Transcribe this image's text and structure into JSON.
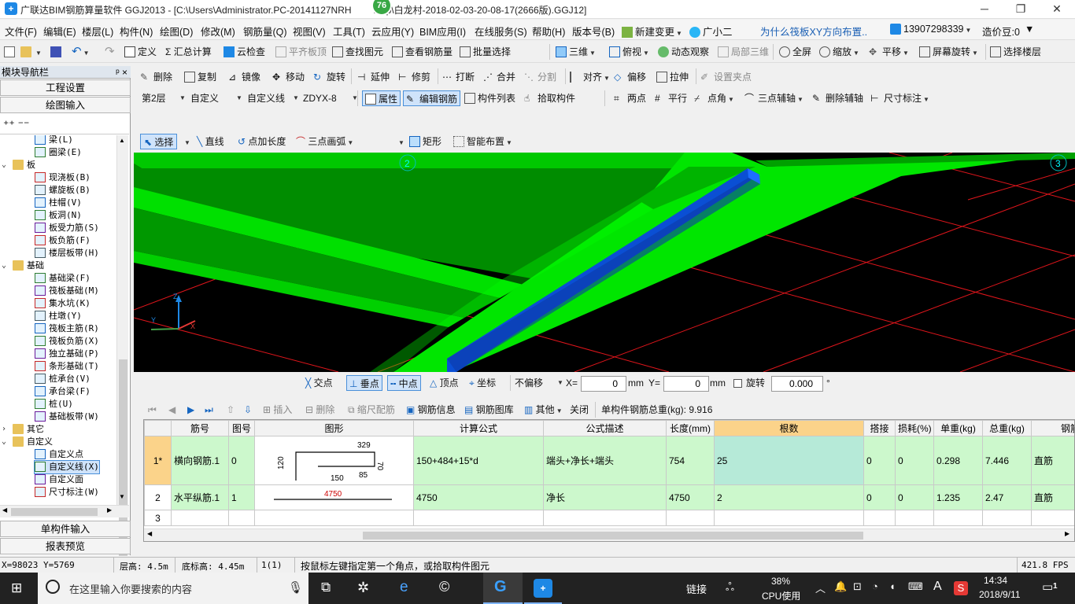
{
  "title": {
    "app": "广联达BIM钢筋算量软件 GGJ2013 - [C:\\Users\\Administrator.PC-20141127NRH",
    "app_tail": "ktop\\白龙村-2018-02-03-20-08-17(2666版).GGJ12]",
    "badge": "76"
  },
  "menu": [
    "文件(F)",
    "编辑(E)",
    "楼层(L)",
    "构件(N)",
    "绘图(D)",
    "修改(M)",
    "钢筋量(Q)",
    "视图(V)",
    "工具(T)",
    "云应用(Y)",
    "BIM应用(I)",
    "在线服务(S)",
    "帮助(H)",
    "版本号(B)",
    "新建变更",
    "广小二",
    "为什么筏板XY方向布置..",
    "13907298339",
    "造价豆:0"
  ],
  "toolbar1": [
    "定义",
    "Σ 汇总计算",
    "云检查",
    "平齐板顶",
    "查找图元",
    "查看钢筋量",
    "批量选择",
    "三维",
    "俯视",
    "动态观察",
    "局部三维",
    "全屏",
    "缩放",
    "平移",
    "屏幕旋转",
    "选择楼层"
  ],
  "toolbar2": [
    "删除",
    "复制",
    "镜像",
    "移动",
    "旋转",
    "延伸",
    "修剪",
    "打断",
    "合并",
    "分割",
    "对齐",
    "偏移",
    "拉伸",
    "设置夹点"
  ],
  "toolbar3": {
    "floor": "第2层",
    "type": "自定义",
    "subtype": "自定义线",
    "code": "ZDYX-8",
    "items": [
      "属性",
      "编辑钢筋",
      "构件列表",
      "拾取构件",
      "两点",
      "平行",
      "点角",
      "三点辅轴",
      "删除辅轴",
      "尺寸标注"
    ]
  },
  "toolbar4": [
    "选择",
    "直线",
    "点加长度",
    "三点画弧",
    "矩形",
    "智能布置"
  ],
  "nav": {
    "header": "模块导航栏",
    "pin": "ᵖ ×",
    "btn_engineering": "工程设置",
    "btn_draw": "绘图输入",
    "btn_single": "单构件输入",
    "btn_report": "报表预览"
  },
  "tree": [
    {
      "label": "梁(L)",
      "level": 2
    },
    {
      "label": "圈梁(E)",
      "level": 2
    },
    {
      "label": "板",
      "level": 1,
      "folder": true
    },
    {
      "label": "现浇板(B)",
      "level": 2
    },
    {
      "label": "螺旋板(B)",
      "level": 2
    },
    {
      "label": "柱帽(V)",
      "level": 2
    },
    {
      "label": "板洞(N)",
      "level": 2
    },
    {
      "label": "板受力筋(S)",
      "level": 2
    },
    {
      "label": "板负筋(F)",
      "level": 2
    },
    {
      "label": "楼层板带(H)",
      "level": 2
    },
    {
      "label": "基础",
      "level": 1,
      "folder": true
    },
    {
      "label": "基础梁(F)",
      "level": 2
    },
    {
      "label": "筏板基础(M)",
      "level": 2
    },
    {
      "label": "集水坑(K)",
      "level": 2
    },
    {
      "label": "柱墩(Y)",
      "level": 2
    },
    {
      "label": "筏板主筋(R)",
      "level": 2
    },
    {
      "label": "筏板负筋(X)",
      "level": 2
    },
    {
      "label": "独立基础(P)",
      "level": 2
    },
    {
      "label": "条形基础(T)",
      "level": 2
    },
    {
      "label": "桩承台(V)",
      "level": 2
    },
    {
      "label": "承台梁(F)",
      "level": 2
    },
    {
      "label": "桩(U)",
      "level": 2
    },
    {
      "label": "基础板带(W)",
      "level": 2
    },
    {
      "label": "其它",
      "level": 1,
      "folder": true,
      "collapsed": true
    },
    {
      "label": "自定义",
      "level": 1,
      "folder": true
    },
    {
      "label": "自定义点",
      "level": 2
    },
    {
      "label": "自定义线(X)",
      "level": 2,
      "selected": true
    },
    {
      "label": "自定义面",
      "level": 2
    },
    {
      "label": "尺寸标注(W)",
      "level": 2
    }
  ],
  "viewport": {
    "axis2": "2",
    "axis3": "3"
  },
  "viewtoolbar": {
    "items": [
      "交点",
      "垂点",
      "中点",
      "顶点",
      "坐标"
    ],
    "offset": "不偏移",
    "x_label": "X=",
    "x_value": "0",
    "y_label": "Y=",
    "y_value": "0",
    "unit": "mm",
    "rotate": "旋转",
    "rotate_value": "0.000",
    "deg": "°"
  },
  "gridtoolbar": {
    "items": [
      "插入",
      "删除",
      "缩尺配筋",
      "钢筋信息",
      "钢筋图库",
      "其他",
      "关闭"
    ],
    "total": "单构件钢筋总重(kg): 9.916"
  },
  "table": {
    "headers": [
      "筋号",
      "图号",
      "图形",
      "计算公式",
      "公式描述",
      "长度(mm)",
      "根数",
      "搭接",
      "损耗(%)",
      "单重(kg)",
      "总重(kg)",
      "钢筋归类"
    ],
    "rows": [
      {
        "idx": "1*",
        "name": "横向钢筋.1",
        "fig": "0",
        "shape": {
          "a": "329",
          "b": "70",
          "c": "120",
          "d": "150",
          "e": "85"
        },
        "formula": "150+484+15*d",
        "desc": "端头+净长+端头",
        "len": "754",
        "count": "25",
        "lap": "0",
        "loss": "0",
        "unit": "0.298",
        "total": "7.446",
        "cat": "直筋"
      },
      {
        "idx": "2",
        "name": "水平纵筋.1",
        "fig": "1",
        "shape": {
          "a": "4750"
        },
        "formula": "4750",
        "desc": "净长",
        "len": "4750",
        "count": "2",
        "lap": "0",
        "loss": "0",
        "unit": "1.235",
        "total": "2.47",
        "cat": "直筋"
      },
      {
        "idx": "3",
        "name": "",
        "fig": "",
        "shape": {},
        "formula": "",
        "desc": "",
        "len": "",
        "count": "",
        "lap": "",
        "loss": "",
        "unit": "",
        "total": "",
        "cat": ""
      }
    ]
  },
  "status": {
    "coords": "X=98023 Y=5769",
    "floor_h": "层高: 4.5m",
    "base_h": "底标高: 4.45m",
    "sel": "1(1)",
    "hint": "按鼠标左键指定第一个角点，或拾取构件图元",
    "fps": "421.8 FPS"
  },
  "taskbar": {
    "search": "在这里输入你要搜索的内容",
    "link": "链接",
    "cpu_pct": "38%",
    "cpu": "CPU使用",
    "time": "14:34",
    "date": "2018/9/11",
    "notif": "1"
  }
}
